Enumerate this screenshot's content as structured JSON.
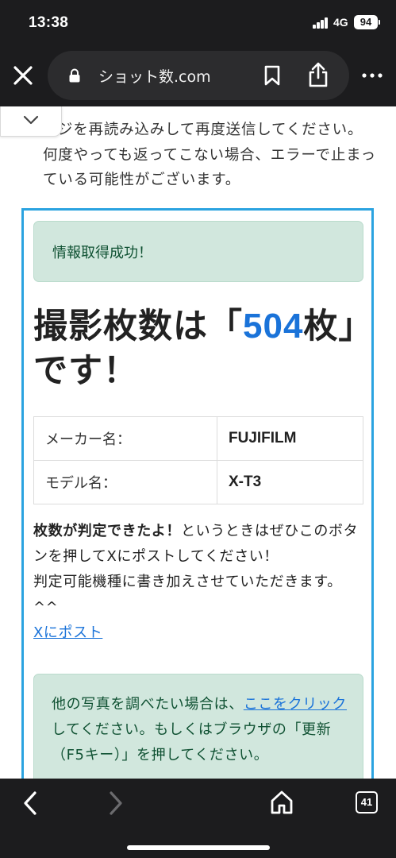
{
  "status_bar": {
    "time": "13:38",
    "network": "4G",
    "battery": "94"
  },
  "toolbar": {
    "url": "ショット数.com"
  },
  "page": {
    "intro_text": "ージを再読み込みして再度送信してください。何度やっても返ってこない場合、エラーで止まっている可能性がございます。",
    "success_message": "情報取得成功！",
    "headline_prefix": "撮影枚数は「",
    "shot_count": "504",
    "headline_suffix": "枚」です！",
    "table": [
      {
        "label": "メーカー名：",
        "value": "FUJIFILM"
      },
      {
        "label": "モデル名：",
        "value": "X-T3"
      }
    ],
    "post_bold": "枚数が判定できたよ！",
    "post_text_1": "というときはぜひこのボタンを押してXにポストしてください！",
    "post_text_2": "判定可能機種に書き加えさせていただきます。^^",
    "post_link": "Xにポスト",
    "retry_text_1": "他の写真を調べたい場合は、",
    "retry_link": "ここをクリック",
    "retry_text_2": "してください。もしくはブラウザの「更新（F5キー）」を押してください。"
  },
  "bottom_nav": {
    "tab_count": "41"
  },
  "colors": {
    "accent": "#1a73d9",
    "border": "#2ba3e0",
    "success_bg": "#d1e7dd",
    "chrome_bg": "#1c1c1e"
  }
}
